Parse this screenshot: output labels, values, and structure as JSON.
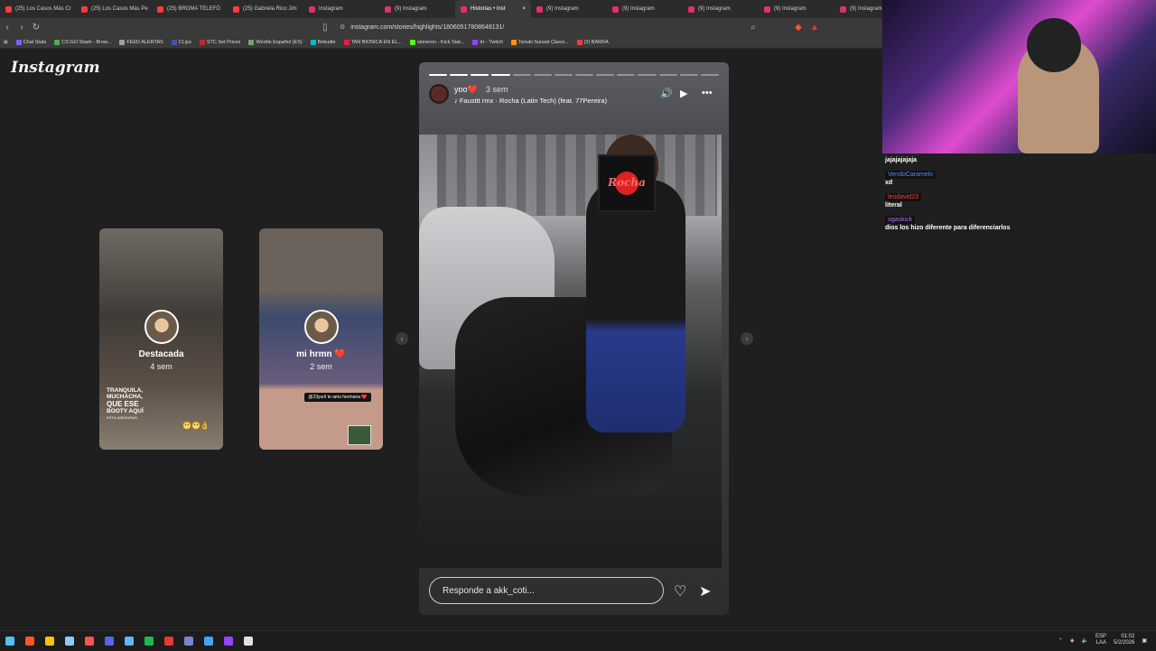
{
  "browser": {
    "tabs": [
      {
        "title": "(25) Los Casos Más Cr",
        "color": "#ff3b3b",
        "active": false
      },
      {
        "title": "(25) Los Casos Más Pe",
        "color": "#ff3b3b",
        "active": false
      },
      {
        "title": "(25) BROMA TELEFÓ",
        "color": "#ff3b3b",
        "active": false
      },
      {
        "title": "(25) Gabriela Rico Jim",
        "color": "#ff3b3b",
        "active": false
      },
      {
        "title": "Instagram",
        "color": "#e1306c",
        "active": false
      },
      {
        "title": "(9) Instagram",
        "color": "#e1306c",
        "active": false
      },
      {
        "title": "Historias • Inst",
        "color": "#e1306c",
        "active": true
      },
      {
        "title": "(9) Instagram",
        "color": "#e1306c",
        "active": false
      },
      {
        "title": "(9) Instagram",
        "color": "#e1306c",
        "active": false
      },
      {
        "title": "(9) Instagram",
        "color": "#e1306c",
        "active": false
      },
      {
        "title": "(9) Instagram",
        "color": "#e1306c",
        "active": false
      },
      {
        "title": "(9) Instagram",
        "color": "#e1306c",
        "active": false
      }
    ],
    "url": "instagram.com/stories/highlights/18060517808648131/",
    "bookmarks": [
      {
        "label": "Chat Stats",
        "color": "#7b61ff"
      },
      {
        "label": "CS:GO Stash - Brow...",
        "color": "#4caf50"
      },
      {
        "label": "FEED ALERTAS",
        "color": "#9e9e9e"
      },
      {
        "label": "CLips",
        "color": "#3f51b5"
      },
      {
        "label": "STC Set Prices",
        "color": "#c62828"
      },
      {
        "label": "Wordle Español (ES)",
        "color": "#6aaa64"
      },
      {
        "label": "Bokudle",
        "color": "#00bcd4"
      },
      {
        "label": "TAN BIONICA EN EL...",
        "color": "#ff1744"
      },
      {
        "label": "sioneron - Kick Stat...",
        "color": "#53fc18"
      },
      {
        "label": "trr - Twitch",
        "color": "#9146ff"
      },
      {
        "label": "Tanuki Sunset Classi...",
        "color": "#ff9800"
      },
      {
        "label": "(2) BARRA",
        "color": "#ff3b3b"
      }
    ]
  },
  "instagram": {
    "logo": "Instagram",
    "highlights": [
      {
        "name": "Destacada",
        "ago": "4 sem",
        "caption_lines": [
          "TRANQUILA,",
          "MUCHACHA,",
          "QUE ESE",
          "BOOTY AQUÍ"
        ],
        "caption_small": "ESTÁ ASEGURAO",
        "emojis": "😬😬👌"
      },
      {
        "name": "mi hrmn ❤️",
        "ago": "2 sem",
        "sticker": "@23yuril te amo hermana ❤️"
      }
    ],
    "story": {
      "username": "yoo",
      "username_emoji": "❤️",
      "ago": "3 sem",
      "song": "Fausttt rmx · Rocha (Latin Tech) (feat. 77Pereira)",
      "progress": {
        "total": 14,
        "done": 4
      },
      "reply_placeholder": "Responde a akk_coti...",
      "sticker_text": "Rocha"
    },
    "accent": "#e1306c"
  },
  "chat": {
    "messages": [
      {
        "user": "",
        "text": "jajajajajaja",
        "color": "#ffffff"
      },
      {
        "user": "VendoCaramelo",
        "text": "xd",
        "color": "#4f8cff"
      },
      {
        "user": "leodavid23",
        "text": "literal",
        "color": "#ff3b3b"
      },
      {
        "user": "ogaskick",
        "text": "dios los hizo diferente para diferenciarlos",
        "color": "#b266ff"
      }
    ]
  },
  "taskbar": {
    "apps": [
      {
        "name": "start-icon",
        "color": "#4fc3f7"
      },
      {
        "name": "brave-icon",
        "color": "#fb542b"
      },
      {
        "name": "folder-icon",
        "color": "#ffc107"
      },
      {
        "name": "steam-icon",
        "color": "#90caf9"
      },
      {
        "name": "obs-icon",
        "color": "#ff5252"
      },
      {
        "name": "discord-icon",
        "color": "#5865f2"
      },
      {
        "name": "monitor-icon",
        "color": "#64b5f6"
      },
      {
        "name": "spotify-icon",
        "color": "#1db954"
      },
      {
        "name": "news-icon",
        "color": "#e53935"
      },
      {
        "name": "app-icon",
        "color": "#7986cb"
      },
      {
        "name": "teamviewer-icon",
        "color": "#42a5f5"
      },
      {
        "name": "twitch-icon",
        "color": "#9146ff"
      },
      {
        "name": "back-icon",
        "color": "#e0e0e0"
      }
    ],
    "lang": "ESP",
    "lang_sub": "LAA",
    "time": "01:02",
    "date": "5/2/2026"
  }
}
